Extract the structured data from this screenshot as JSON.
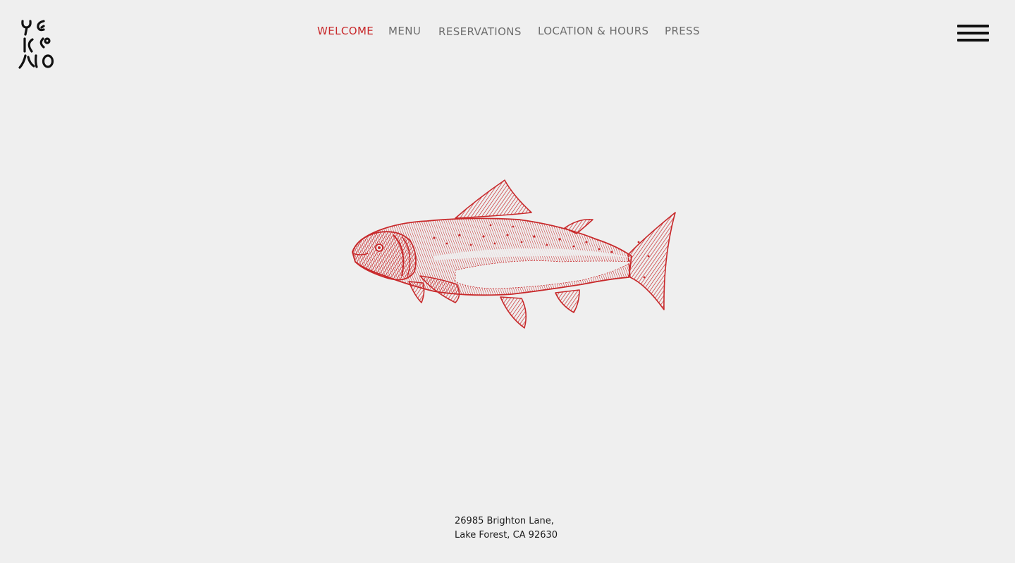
{
  "brand": {
    "logo_icon": "yakimo-glyph-logo",
    "accent_color": "#c8292b",
    "background_color": "#efefef"
  },
  "nav": {
    "items": [
      {
        "label": "WELCOME",
        "active": true
      },
      {
        "label": "MENU",
        "active": false
      },
      {
        "label": "RESERVATIONS",
        "active": false
      },
      {
        "label": "LOCATION & HOURS",
        "active": false
      },
      {
        "label": "PRESS",
        "active": false
      }
    ],
    "menu_icon": "hamburger-icon"
  },
  "hero": {
    "image_icon": "salmon-illustration"
  },
  "footer": {
    "address_line1": "26985 Brighton Lane,",
    "address_line2": "Lake Forest, CA 92630"
  }
}
